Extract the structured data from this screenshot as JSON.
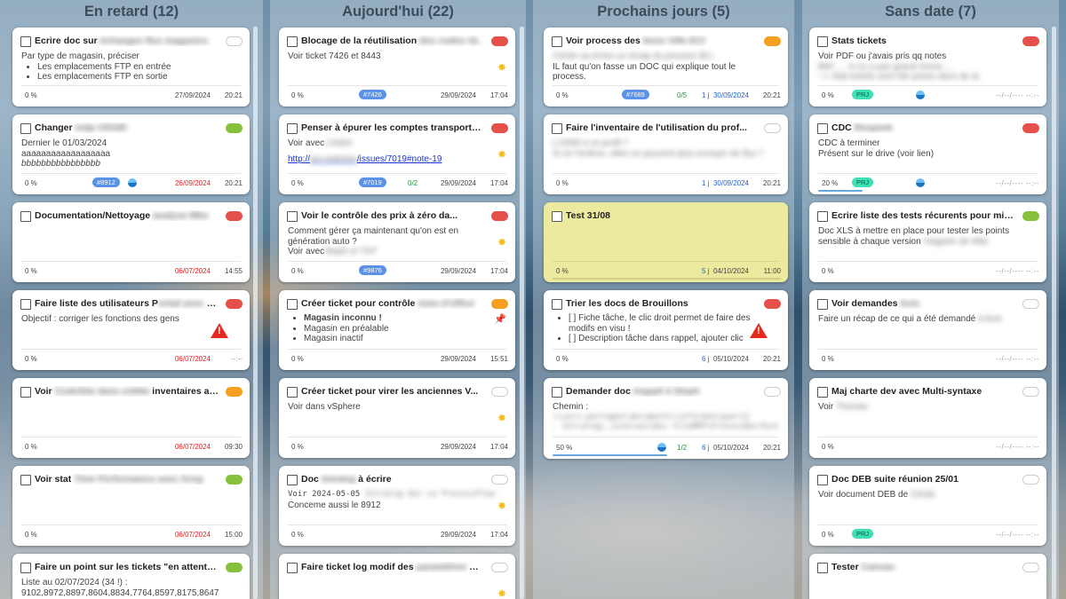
{
  "columns": [
    {
      "title": "En retard (12)"
    },
    {
      "title": "Aujourd'hui (22)"
    },
    {
      "title": "Prochains jours (5)"
    },
    {
      "title": "Sans date (7)"
    }
  ],
  "cards": {
    "c1": {
      "title": "Ecrire doc sur",
      "title_blur": "échanges flux magasins",
      "desc1": "Par type de magasin, préciser",
      "li1": "Les emplacements FTP en entrée",
      "li2": "Les emplacements FTP en sortie",
      "pct": "0 %",
      "date": "27/09/2024",
      "time": "20:21"
    },
    "c2": {
      "title": "Changer",
      "title_blur": "mdp CEGID",
      "desc1": "Dernier le 01/03/2024",
      "desc2": "aaaaaaaaaaaaaaaaaa",
      "desc3": "bbbbbbbbbbbbbbbb",
      "pct": "0 %",
      "tag": "#8912",
      "date": "26/09/2024",
      "time": "20:21"
    },
    "c3": {
      "title": "Documentation/Nettoyage",
      "title_blur": "analyse Mbs",
      "pct": "0 %",
      "date": "06/07/2024",
      "time": "14:55"
    },
    "c4": {
      "title": "Faire liste des utilisateurs P",
      "title_blur": "ortail avec BB",
      "desc1": "Objectif : corriger les fonctions des gens",
      "pct": "0 %",
      "date": "06/07/2024",
      "time": "--:--"
    },
    "c5": {
      "title": "Voir",
      "title_blur": "CodeSite dans entête",
      "title_end": "inventaires ave...",
      "pct": "0 %",
      "date": "06/07/2024",
      "time": "09:30"
    },
    "c6": {
      "title": "Voir stat",
      "title_blur": "Time Performance avec Greg",
      "pct": "0 %",
      "date": "06/07/2024",
      "time": "15:00"
    },
    "c7": {
      "title": "Faire un point sur les tickets \"en attente d...",
      "desc1": "Liste au 02/07/2024 (34 !) :",
      "desc2": "9102,8972,8897,8604,8834,7764,8597,8175,8647"
    },
    "d1": {
      "title": "Blocage de la réutilisation",
      "title_blur": "des codes UL",
      "desc1": "Voir ticket 7426 et 8443",
      "pct": "0 %",
      "tag": "#7426",
      "date": "29/09/2024",
      "time": "17:04"
    },
    "d2": {
      "title": "Penser à épurer les comptes transporteurs",
      "desc1": "Voir avec",
      "desc1_blur": "Cédric",
      "link_a": "http://",
      "link_blur": "srv-redmine",
      "link_b": "/issues/7019#note-19",
      "pct": "0 %",
      "tag": "#7019",
      "chk": "0/2",
      "date": "29/09/2024",
      "time": "17:04"
    },
    "d3": {
      "title": "Voir le contrôle des prix à zéro da...",
      "desc1": "Comment gérer ça maintenant qu'on est en",
      "desc2": "génération auto ?",
      "desc3": "Voir avec",
      "desc3_blur": "Steph et TNT",
      "pct": "0 %",
      "tag": "#9876",
      "date": "29/09/2024",
      "time": "17:04"
    },
    "d4": {
      "title": "Créer ticket pour contrôle",
      "title_blur": "mise d'office",
      "li1": "Magasin inconnu  !",
      "li2": "Magasin en préalable",
      "li3": "Magasin inactif",
      "pct": "0 %",
      "date": "29/09/2024",
      "time": "15:51"
    },
    "d5": {
      "title": "Créer ticket pour virer les anciennes V...",
      "desc1": "Voir dans vSphere",
      "pct": "0 %",
      "date": "29/09/2024",
      "time": "17:04"
    },
    "d6": {
      "title": "Doc",
      "title_blur": "Intralog",
      "title_end": "à écrire",
      "desc1": "Voir 2024-05-05",
      "desc1_blur": "Intralog Doc Le ProcessFlow",
      "desc2": "Conceme aussi le 8912",
      "pct": "0 %",
      "date": "29/09/2024",
      "time": "17:04"
    },
    "d7": {
      "title": "Faire ticket log modif des",
      "title_blur": "paramètres Mbs"
    },
    "p1": {
      "title": "Voir process des",
      "title_blur": "bons Ville ECI",
      "desc1_blur": "Cécile va écrire un récap du process BLI.",
      "desc2": "IL faut qu'on fasse un DOC qui explique tout le",
      "desc3": "process.",
      "pct": "0 %",
      "tag": "#7689",
      "chk": "0/5",
      "days": "1 j",
      "date": "30/09/2024",
      "time": "20:21"
    },
    "p2": {
      "title": "Faire l'inventaire de l'utilisation du prof...",
      "desc1_blur": "L'ODM a ce profil ?",
      "desc2_blur": "Si on l'enlève, elles ne peuvent plus envoyer de flux ?",
      "pct": "0 %",
      "days": "1 j",
      "date": "30/09/2024",
      "time": "20:21"
    },
    "p3": {
      "title": "Test 31/08",
      "pct": "0 %",
      "days": "5 j",
      "date": "04/10/2024",
      "time": "11:00"
    },
    "p4": {
      "title": "Trier les docs de Brouillons",
      "li1": "[ ] Fiche tâche, le clic droit permet de faire des",
      "li1b": "modifs en visu !",
      "li2": "[ ] Description tâche dans rappel, ajouter clic",
      "pct": "0 %",
      "days": "6 j",
      "date": "05/10/2024",
      "time": "20:21"
    },
    "p5": {
      "title": "Demander doc",
      "title_blur": "inappli à Steph",
      "desc1": "Chemin :",
      "desc2_blur": "\\\\serv-partages\\documents\\informatique\\11",
      "desc3_blur": "- Intralog\\_internes\\Doc FileMPP\\ProcessDocTest",
      "pct": "50 %",
      "chk": "1/2",
      "days": "6 j",
      "date": "05/10/2024",
      "time": "20:21"
    },
    "s1": {
      "title": "Stats tickets",
      "desc1": "Voir PDF ou j'avais pris qq notes",
      "desc2_blur": "BbF .... il n'y a pas grand chose ...",
      "desc3_blur": "--> Stat tickets sont été prises alors de la",
      "pct": "0 %",
      "tag": "PRJ",
      "dashes": "--/--/---- --:--"
    },
    "s2": {
      "title": "CDC",
      "title_blur": "Rexpeek",
      "desc1": "CDC à terminer",
      "desc2": "Présent sur le drive (voir lien)",
      "pct": "20 %",
      "tag": "PRJ",
      "dashes": "--/--/---- --:--"
    },
    "s3": {
      "title": "Ecrire liste des tests récurents pour mise ...",
      "desc1": "Doc XLS à mettre en place pour tester les points",
      "desc2": "sensible à chaque version",
      "desc2_blur": "magasin de Mbs",
      "pct": "0 %",
      "dashes": "--/--/---- --:--"
    },
    "s4": {
      "title": "Voir demandes",
      "title_blur": "Axis",
      "desc1": "Faire un récap de ce qui a été demandé",
      "desc1_blur": "à Axis",
      "pct": "0 %",
      "dashes": "--/--/---- --:--"
    },
    "s5": {
      "title": "Maj charte dev avec Multi-syntaxe",
      "desc1": "Voir",
      "desc1_blur": "Thomas",
      "pct": "0 %",
      "dashes": "--/--/---- --:--"
    },
    "s6": {
      "title": "Doc DEB suite réunion 25/01",
      "desc1": "Voir document DEB de",
      "desc1_blur": "Cécile",
      "pct": "0 %",
      "tag": "PRJ",
      "dashes": "--/--/---- --:--"
    },
    "s7": {
      "title": "Tester",
      "title_blur": "Canvas"
    }
  },
  "colors": {
    "priority_red": "#e5514a",
    "priority_orange": "#f5a021",
    "priority_green": "#86c13c",
    "overdue_date": "#e11c1c",
    "upcoming_date": "#2363c8",
    "ticket_tag": "#5992e6",
    "prj_tag": "#3fe0b4"
  },
  "icons": [
    "warning-icon",
    "star-icon",
    "pin-icon",
    "checkbox-icon",
    "avatar-icon",
    "priority-dot"
  ]
}
